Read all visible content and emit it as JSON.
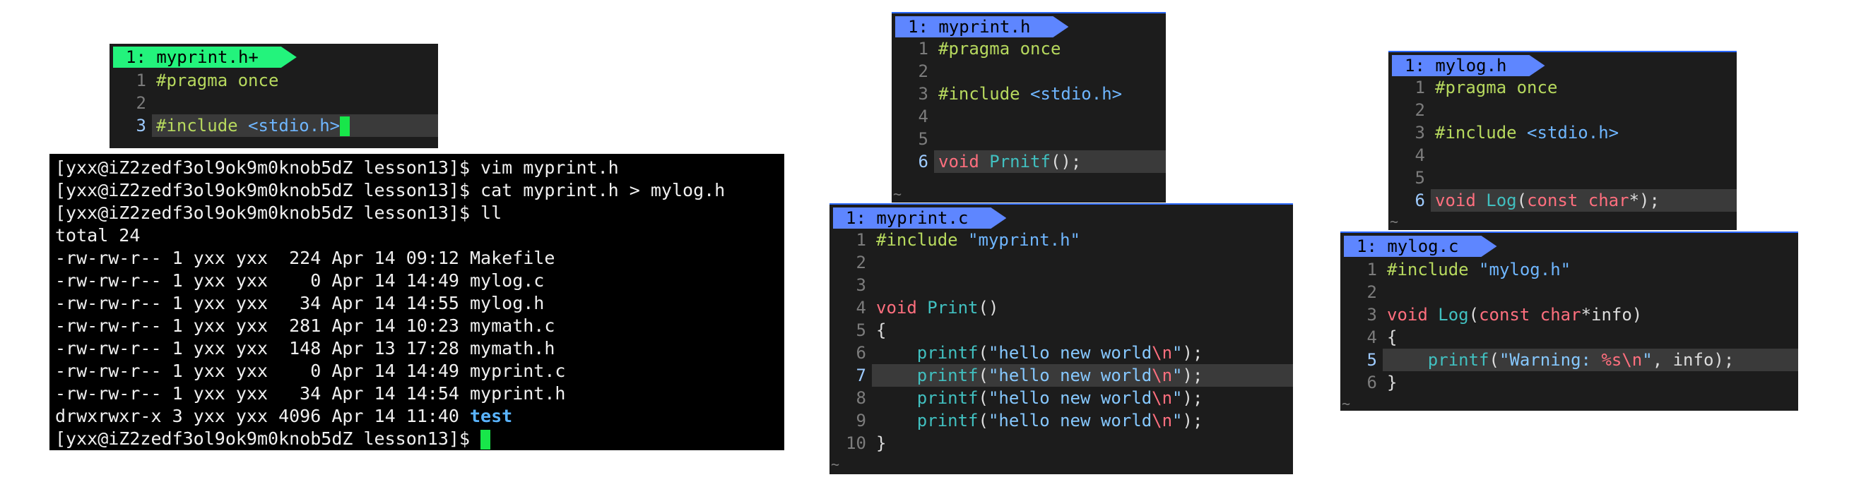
{
  "panels": {
    "p1": {
      "tab": "1: myprint.h+",
      "lines": [
        {
          "n": "1",
          "segs": [
            {
              "t": "#pragma once",
              "c": "pp"
            }
          ]
        },
        {
          "n": "2",
          "segs": []
        },
        {
          "n": "3",
          "segs": [
            {
              "t": "#include ",
              "c": "pp"
            },
            {
              "t": "<stdio.h>",
              "c": "inc"
            }
          ]
        }
      ]
    },
    "p2": {
      "tab": "1: myprint.h",
      "lines": [
        {
          "n": "1",
          "segs": [
            {
              "t": "#pragma once",
              "c": "pp"
            }
          ]
        },
        {
          "n": "2",
          "segs": []
        },
        {
          "n": "3",
          "segs": [
            {
              "t": "#include ",
              "c": "pp"
            },
            {
              "t": "<stdio.h>",
              "c": "inc"
            }
          ]
        },
        {
          "n": "4",
          "segs": []
        },
        {
          "n": "5",
          "segs": []
        },
        {
          "n": "6",
          "segs": [
            {
              "t": "void ",
              "c": "kw"
            },
            {
              "t": "Prnitf",
              "c": "fn"
            },
            {
              "t": "();",
              "c": "punc"
            }
          ]
        }
      ],
      "tilde": "~"
    },
    "p3": {
      "tab": "1: myprint.c",
      "lines": [
        {
          "n": "1",
          "segs": [
            {
              "t": "#include ",
              "c": "pp"
            },
            {
              "t": "\"myprint.h\"",
              "c": "inc"
            }
          ]
        },
        {
          "n": "2",
          "segs": []
        },
        {
          "n": "3",
          "segs": []
        },
        {
          "n": "4",
          "segs": [
            {
              "t": "void ",
              "c": "kw"
            },
            {
              "t": "Print",
              "c": "fn"
            },
            {
              "t": "()",
              "c": "punc"
            }
          ]
        },
        {
          "n": "5",
          "segs": [
            {
              "t": "{",
              "c": "punc"
            }
          ]
        },
        {
          "n": "6",
          "segs": [
            {
              "t": "    ",
              "c": "punc"
            },
            {
              "t": "printf",
              "c": "fn"
            },
            {
              "t": "(",
              "c": "punc"
            },
            {
              "t": "\"hello new world",
              "c": "str"
            },
            {
              "t": "\\n",
              "c": "esc"
            },
            {
              "t": "\"",
              "c": "str"
            },
            {
              "t": ");",
              "c": "punc"
            }
          ]
        },
        {
          "n": "7",
          "segs": [
            {
              "t": "    ",
              "c": "punc"
            },
            {
              "t": "printf",
              "c": "fn"
            },
            {
              "t": "(",
              "c": "punc"
            },
            {
              "t": "\"hello new world",
              "c": "str"
            },
            {
              "t": "\\n",
              "c": "esc"
            },
            {
              "t": "\"",
              "c": "str"
            },
            {
              "t": ");",
              "c": "punc"
            }
          ]
        },
        {
          "n": "8",
          "segs": [
            {
              "t": "    ",
              "c": "punc"
            },
            {
              "t": "printf",
              "c": "fn"
            },
            {
              "t": "(",
              "c": "punc"
            },
            {
              "t": "\"hello new world",
              "c": "str"
            },
            {
              "t": "\\n",
              "c": "esc"
            },
            {
              "t": "\"",
              "c": "str"
            },
            {
              "t": ");",
              "c": "punc"
            }
          ]
        },
        {
          "n": "9",
          "segs": [
            {
              "t": "    ",
              "c": "punc"
            },
            {
              "t": "printf",
              "c": "fn"
            },
            {
              "t": "(",
              "c": "punc"
            },
            {
              "t": "\"hello new world",
              "c": "str"
            },
            {
              "t": "\\n",
              "c": "esc"
            },
            {
              "t": "\"",
              "c": "str"
            },
            {
              "t": ");",
              "c": "punc"
            }
          ]
        },
        {
          "n": "10",
          "segs": [
            {
              "t": "}",
              "c": "punc"
            }
          ]
        }
      ],
      "tilde": "~"
    },
    "p4": {
      "tab": "1: mylog.h",
      "lines": [
        {
          "n": "1",
          "segs": [
            {
              "t": "#pragma once",
              "c": "pp"
            }
          ]
        },
        {
          "n": "2",
          "segs": []
        },
        {
          "n": "3",
          "segs": [
            {
              "t": "#include ",
              "c": "pp"
            },
            {
              "t": "<stdio.h>",
              "c": "inc"
            }
          ]
        },
        {
          "n": "4",
          "segs": []
        },
        {
          "n": "5",
          "segs": []
        },
        {
          "n": "6",
          "segs": [
            {
              "t": "void ",
              "c": "kw"
            },
            {
              "t": "Log",
              "c": "fn"
            },
            {
              "t": "(",
              "c": "punc"
            },
            {
              "t": "const char",
              "c": "kw"
            },
            {
              "t": "*);",
              "c": "punc"
            }
          ]
        }
      ],
      "tilde": "~"
    },
    "p5": {
      "tab": "1: mylog.c",
      "lines": [
        {
          "n": "1",
          "segs": [
            {
              "t": "#include ",
              "c": "pp"
            },
            {
              "t": "\"mylog.h\"",
              "c": "inc"
            }
          ]
        },
        {
          "n": "2",
          "segs": []
        },
        {
          "n": "3",
          "segs": [
            {
              "t": "void ",
              "c": "kw"
            },
            {
              "t": "Log",
              "c": "fn"
            },
            {
              "t": "(",
              "c": "punc"
            },
            {
              "t": "const char",
              "c": "kw"
            },
            {
              "t": "*info)",
              "c": "punc"
            }
          ]
        },
        {
          "n": "4",
          "segs": [
            {
              "t": "{",
              "c": "punc"
            }
          ]
        },
        {
          "n": "5",
          "segs": [
            {
              "t": "    ",
              "c": "punc"
            },
            {
              "t": "printf",
              "c": "fn"
            },
            {
              "t": "(",
              "c": "punc"
            },
            {
              "t": "\"Warning: ",
              "c": "str"
            },
            {
              "t": "%s\\n",
              "c": "esc"
            },
            {
              "t": "\"",
              "c": "str"
            },
            {
              "t": ", info);",
              "c": "punc"
            }
          ]
        },
        {
          "n": "6",
          "segs": [
            {
              "t": "}",
              "c": "punc"
            }
          ]
        }
      ],
      "tilde": "~"
    }
  },
  "terminal": {
    "lines": [
      "[yxx@iZ2zedf3ol9ok9m0knob5dZ lesson13]$ vim myprint.h",
      "[yxx@iZ2zedf3ol9ok9m0knob5dZ lesson13]$ cat myprint.h > mylog.h",
      "[yxx@iZ2zedf3ol9ok9m0knob5dZ lesson13]$ ll",
      "total 24",
      "-rw-rw-r-- 1 yxx yxx  224 Apr 14 09:12 Makefile",
      "-rw-rw-r-- 1 yxx yxx    0 Apr 14 14:49 mylog.c",
      "-rw-rw-r-- 1 yxx yxx   34 Apr 14 14:55 mylog.h",
      "-rw-rw-r-- 1 yxx yxx  281 Apr 14 10:23 mymath.c",
      "-rw-rw-r-- 1 yxx yxx  148 Apr 13 17:28 mymath.h",
      "-rw-rw-r-- 1 yxx yxx    0 Apr 14 14:49 myprint.c",
      "-rw-rw-r-- 1 yxx yxx   34 Apr 14 14:54 myprint.h"
    ],
    "dir_line_prefix": "drwxrwxr-x 3 yxx yxx 4096 Apr 14 11:40 ",
    "dir_name": "test",
    "prompt": "[yxx@iZ2zedf3ol9ok9m0knob5dZ lesson13]$ "
  }
}
